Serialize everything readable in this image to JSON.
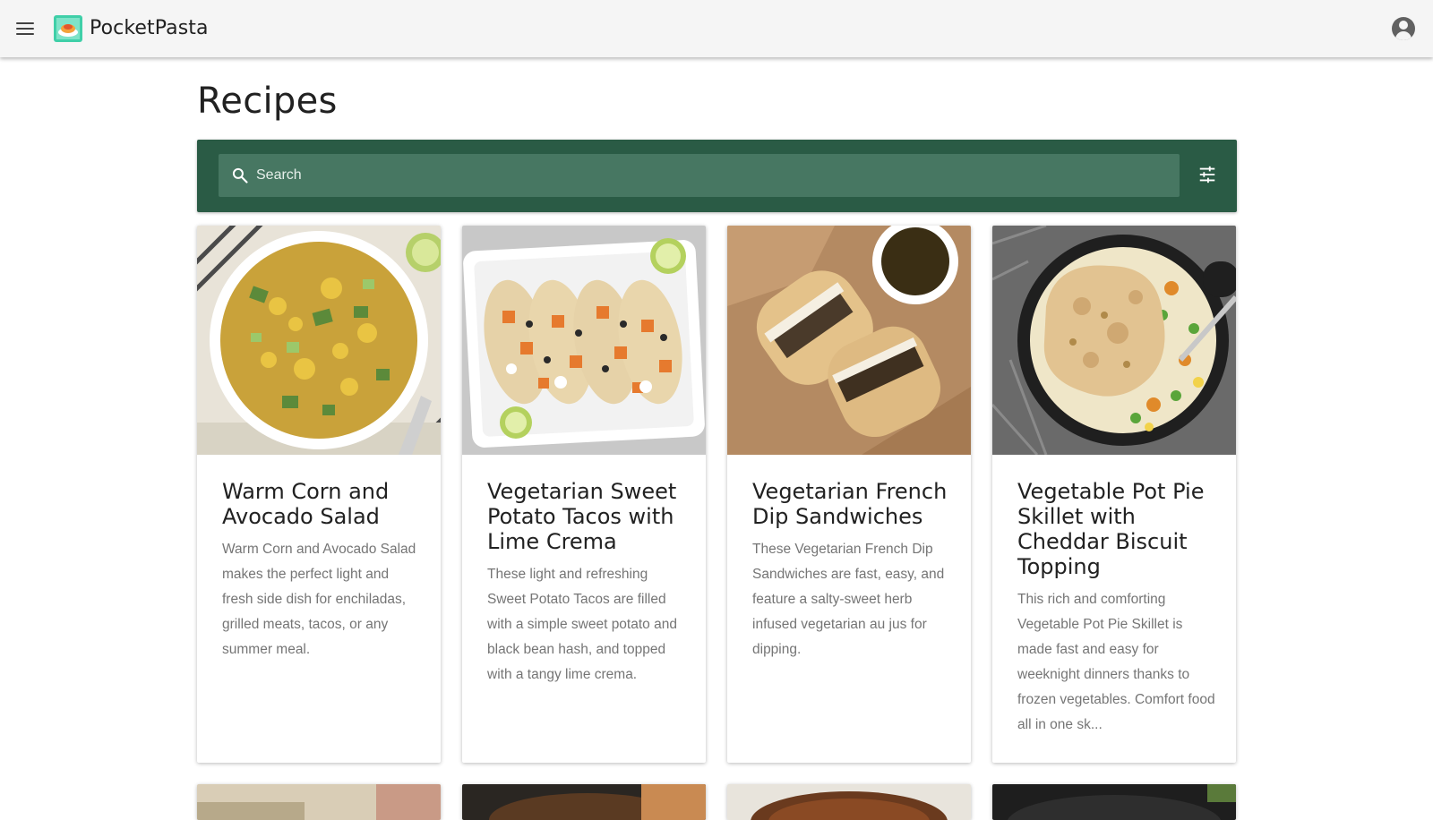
{
  "app": {
    "title": "PocketPasta",
    "menu_icon": "hamburger-menu-icon",
    "account_icon": "account-circle-icon"
  },
  "page": {
    "title": "Recipes"
  },
  "search": {
    "placeholder": "Search",
    "value": "",
    "filter_icon": "tune-filter-icon"
  },
  "colors": {
    "appbar_bg": "#f5f5f5",
    "search_bar_bg": "#2a5b45",
    "search_field_bg": "#477762",
    "text_primary": "#212121",
    "text_secondary": "#757575"
  },
  "recipes": [
    {
      "title": "Warm Corn and Avocado Salad",
      "description": "Warm Corn and Avocado Salad makes the perfect light and fresh side dish for enchiladas, grilled meats, tacos, or any summer meal."
    },
    {
      "title": "Vegetarian Sweet Potato Tacos with Lime Crema",
      "description": "These light and refreshing Sweet Potato Tacos are filled with a simple sweet potato and black bean hash, and topped with a tangy lime crema."
    },
    {
      "title": "Vegetarian French Dip Sandwiches",
      "description": "These Vegetarian French Dip Sandwiches are fast, easy, and feature a salty-sweet herb infused vegetarian au jus for dipping."
    },
    {
      "title": "Vegetable Pot Pie Skillet with Cheddar Biscuit Topping",
      "description": "This rich and comforting Vegetable Pot Pie Skillet is made fast and easy for weeknight dinners thanks to frozen vegetables. Comfort food all in one sk..."
    }
  ]
}
